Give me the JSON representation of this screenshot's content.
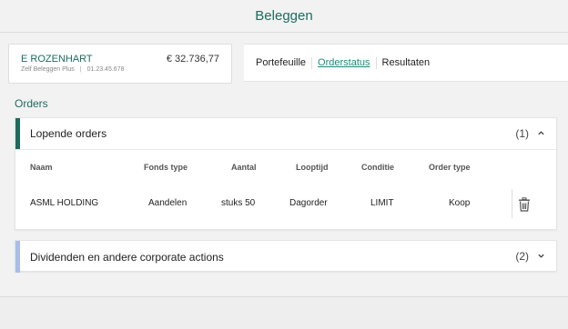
{
  "header": {
    "title": "Beleggen"
  },
  "account": {
    "name": "E ROZENHART",
    "product": "Zelf Beleggen Plus",
    "number": "01.23.45.678",
    "balance": "€ 32.736,77"
  },
  "nav": {
    "items": [
      {
        "label": "Portefeuille",
        "active": false
      },
      {
        "label": "Orderstatus",
        "active": true
      },
      {
        "label": "Resultaten",
        "active": false
      }
    ]
  },
  "section": {
    "title": "Orders"
  },
  "running_orders": {
    "title": "Lopende orders",
    "count": "(1)",
    "accent_color": "#1e6b5e",
    "columns": [
      "Naam",
      "Fonds type",
      "Aantal",
      "Looptijd",
      "Conditie",
      "Order type"
    ],
    "rows": [
      {
        "name": "ASML HOLDING",
        "fund_type": "Aandelen",
        "amount": "stuks 50",
        "duration": "Dagorder",
        "condition": "LIMIT",
        "order_type": "Koop"
      }
    ]
  },
  "dividends": {
    "title": "Dividenden en andere corporate actions",
    "count": "(2)",
    "accent_color": "#a9bdea"
  },
  "icons": {
    "collapse": "chevron-up-icon",
    "expand": "chevron-down-icon",
    "delete": "trash-icon"
  }
}
